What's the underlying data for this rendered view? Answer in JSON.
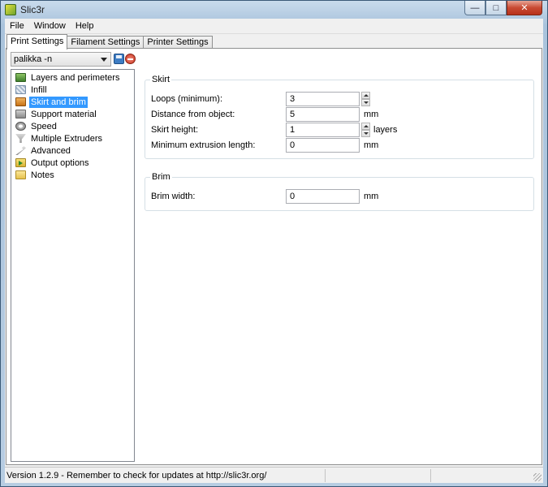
{
  "window": {
    "title": "Slic3r"
  },
  "menubar": {
    "items": [
      "File",
      "Window",
      "Help"
    ]
  },
  "tabs": [
    {
      "label": "Print Settings",
      "active": true
    },
    {
      "label": "Filament Settings",
      "active": false
    },
    {
      "label": "Printer Settings",
      "active": false
    }
  ],
  "preset": {
    "selected": "palikka -n"
  },
  "sidebar": {
    "items": [
      {
        "label": "Layers and perimeters",
        "icon": "layers-icon"
      },
      {
        "label": "Infill",
        "icon": "infill-icon"
      },
      {
        "label": "Skirt and brim",
        "icon": "skirt-icon",
        "selected": true
      },
      {
        "label": "Support material",
        "icon": "support-icon"
      },
      {
        "label": "Speed",
        "icon": "speed-icon"
      },
      {
        "label": "Multiple Extruders",
        "icon": "extruders-icon"
      },
      {
        "label": "Advanced",
        "icon": "wrench-icon"
      },
      {
        "label": "Output options",
        "icon": "output-icon"
      },
      {
        "label": "Notes",
        "icon": "notes-icon"
      }
    ]
  },
  "skirt": {
    "title": "Skirt",
    "loops": {
      "label": "Loops (minimum):",
      "value": "3"
    },
    "distance": {
      "label": "Distance from object:",
      "value": "5",
      "unit": "mm"
    },
    "height": {
      "label": "Skirt height:",
      "value": "1",
      "unit": "layers"
    },
    "min_extrusion": {
      "label": "Minimum extrusion length:",
      "value": "0",
      "unit": "mm"
    }
  },
  "brim": {
    "title": "Brim",
    "width": {
      "label": "Brim width:",
      "value": "0",
      "unit": "mm"
    }
  },
  "statusbar": {
    "text": "Version 1.2.9 - Remember to check for updates at http://slic3r.org/"
  },
  "colors": {
    "selection": "#3399ff",
    "frame": "#b7cde2",
    "close_button": "#c84a33"
  }
}
